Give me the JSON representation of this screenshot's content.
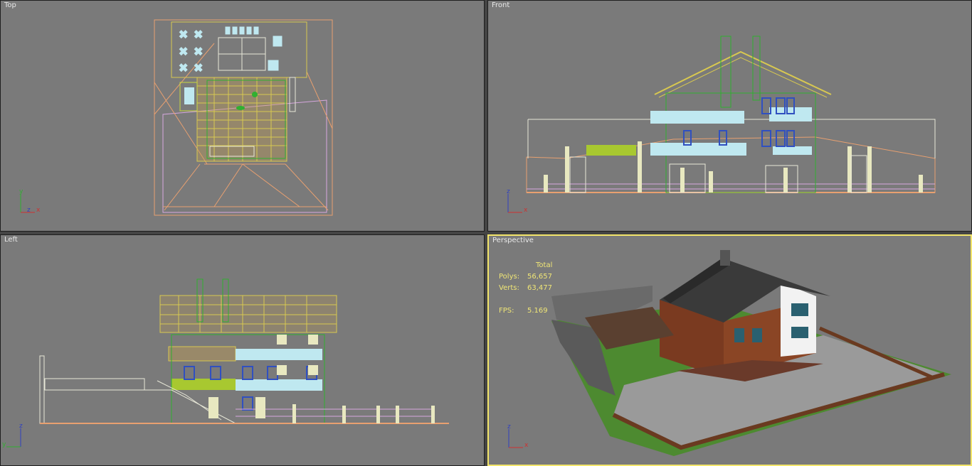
{
  "viewports": {
    "top": {
      "label": "Top"
    },
    "front": {
      "label": "Front"
    },
    "left": {
      "label": "Left"
    },
    "perspective": {
      "label": "Perspective"
    }
  },
  "stats": {
    "header": "Total",
    "polys_label": "Polys:",
    "polys_value": "56,657",
    "verts_label": "Verts:",
    "verts_value": "63,477",
    "fps_label": "FPS:",
    "fps_value": "5.169"
  },
  "axis": {
    "x": "x",
    "y": "y",
    "z": "z"
  },
  "colors": {
    "viewport_bg": "#7a7a7a",
    "active_border": "#f3e56a",
    "stats_text": "#f0e676",
    "wire_orange": "#e8a070",
    "wire_yellow": "#d8c850",
    "wire_green": "#30b030",
    "wire_lightblue": "#bfe8f0",
    "wire_blue": "#3050c0"
  }
}
